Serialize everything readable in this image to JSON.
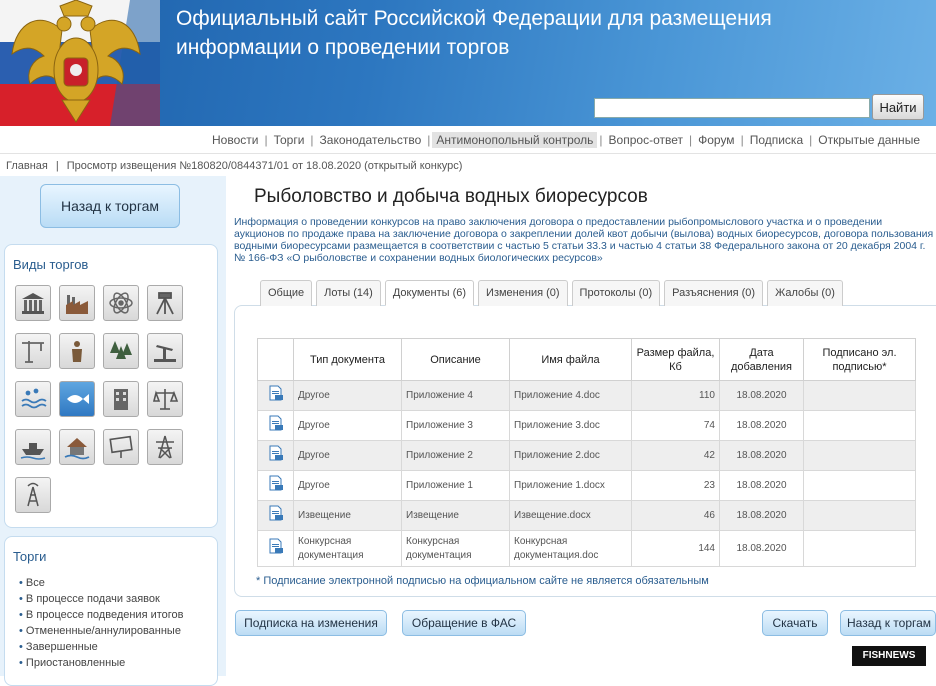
{
  "header": {
    "title_line1": "Официальный сайт Российской Федерации для размещения",
    "title_line2": "информации о проведении торгов",
    "search_placeholder": "",
    "search_button": "Найти",
    "colors": {
      "brand_blue": "#2d77c0",
      "link_blue": "#2a5d8f"
    }
  },
  "topnav": {
    "items": [
      "Новости",
      "Торги",
      "Законодательство",
      "Антимонопольный контроль",
      "Вопрос-ответ",
      "Форум",
      "Подписка",
      "Открытые данные"
    ],
    "active": "Антимонопольный контроль"
  },
  "breadcrumb": {
    "home": "Главная",
    "current": "Просмотр извещения №180820/0844371/01 от 18.08.2020 (открытый конкурс)"
  },
  "sidebar": {
    "back_button": "Назад к торгам",
    "types_title": "Виды торгов",
    "type_icons": [
      "government-building-icon",
      "factory-icon",
      "atom-icon",
      "survey-tripod-icon",
      "crane-icon",
      "person-icon",
      "forest-icon",
      "oil-pump-icon",
      "water-icon",
      "fish-icon",
      "building-icon",
      "scales-icon",
      "boat-icon",
      "house-flood-icon",
      "billboard-icon",
      "power-tower-icon",
      "antenna-tower-icon"
    ],
    "torgi_title": "Торги",
    "torgi_items": [
      "Все",
      "В процессе подачи заявок",
      "В процессе подведения итогов",
      "Отмененные/аннулированные",
      "Завершенные",
      "Приостановленные"
    ]
  },
  "main": {
    "title": "Рыболовство и добыча водных биоресурсов",
    "info": "Информация о проведении конкурсов на право заключения договора о предоставлении рыбопромыслового участка и о проведении аукционов по продаже права на заключение договора о закреплении долей квот добычи (вылова) водных биоресурсов, договора пользования водными биоресурсами размещается в соответствии с частью 5 статьи 33.3 и частью 4 статьи 38 Федерального закона от 20 декабря 2004 г. № 166-ФЗ «О рыболовстве и сохранении водных биологических ресурсов»",
    "tabs": [
      {
        "label": "Общие"
      },
      {
        "label": "Лоты (14)"
      },
      {
        "label": "Документы (6)"
      },
      {
        "label": "Изменения (0)"
      },
      {
        "label": "Протоколы (0)"
      },
      {
        "label": "Разъяснения (0)"
      },
      {
        "label": "Жалобы (0)"
      }
    ],
    "active_tab": "Документы (6)",
    "table": {
      "headers": [
        "Тип документа",
        "Описание",
        "Имя файла",
        "Размер файла, Кб",
        "Дата добавления",
        "Подписано эл. подписью*"
      ],
      "rows": [
        {
          "type": "Другое",
          "desc": "Приложение 4",
          "file": "Приложение 4.doc",
          "size": "110",
          "date": "18.08.2020",
          "signed": ""
        },
        {
          "type": "Другое",
          "desc": "Приложение 3",
          "file": "Приложение 3.doc",
          "size": "74",
          "date": "18.08.2020",
          "signed": ""
        },
        {
          "type": "Другое",
          "desc": "Приложение 2",
          "file": "Приложение 2.doc",
          "size": "42",
          "date": "18.08.2020",
          "signed": ""
        },
        {
          "type": "Другое",
          "desc": "Приложение 1",
          "file": "Приложение 1.docx",
          "size": "23",
          "date": "18.08.2020",
          "signed": ""
        },
        {
          "type": "Извещение",
          "desc": "Извещение",
          "file": "Извещение.docx",
          "size": "46",
          "date": "18.08.2020",
          "signed": ""
        },
        {
          "type": "Конкурсная документация",
          "desc": "Конкурсная документация",
          "file": "Конкурсная документация.doc",
          "size": "144",
          "date": "18.08.2020",
          "signed": ""
        }
      ]
    },
    "footnote": "* Подписание электронной подписью на официальном сайте не является обязательным",
    "buttons": {
      "subscribe": "Подписка на изменения",
      "fas": "Обращение в ФАС",
      "download": "Скачать",
      "back": "Назад к торгам"
    }
  },
  "watermark": "FISHNEWS"
}
